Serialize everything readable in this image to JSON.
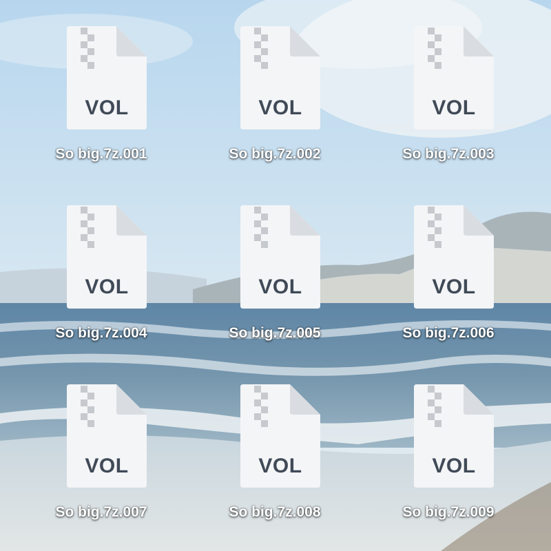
{
  "desktop": {
    "files": [
      {
        "name": "So big.7z.001",
        "type_label": "VOL"
      },
      {
        "name": "So big.7z.002",
        "type_label": "VOL"
      },
      {
        "name": "So big.7z.003",
        "type_label": "VOL"
      },
      {
        "name": "So big.7z.004",
        "type_label": "VOL"
      },
      {
        "name": "So big.7z.005",
        "type_label": "VOL"
      },
      {
        "name": "So big.7z.006",
        "type_label": "VOL"
      },
      {
        "name": "So big.7z.007",
        "type_label": "VOL"
      },
      {
        "name": "So big.7z.008",
        "type_label": "VOL"
      },
      {
        "name": "So big.7z.009",
        "type_label": "VOL"
      }
    ]
  },
  "icon": {
    "name": "zip-archive-document-icon",
    "page_color": "#f4f5f7",
    "fold_color": "#d9dde2",
    "zipper_color": "#c6c9cd",
    "label_color": "#404a57"
  }
}
